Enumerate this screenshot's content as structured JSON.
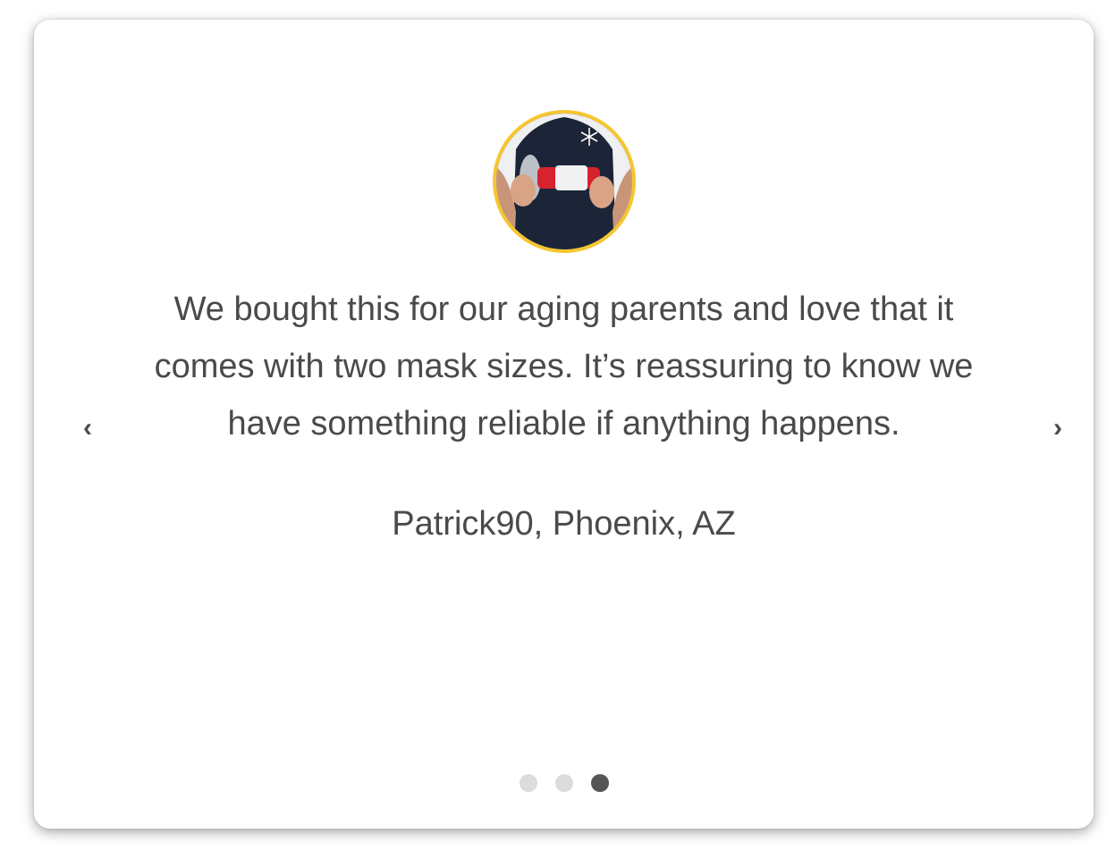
{
  "testimonial": {
    "quote": "We bought this for our aging parents and love that it comes with two mask sizes. It’s reassuring to know we have something reliable if anything happens.",
    "author": "Patrick90, Phoenix, AZ",
    "avatar_icon": "person-holding-anti-choking-device"
  },
  "carousel": {
    "prev_label": "‹",
    "next_label": "›",
    "total_slides": 3,
    "active_slide": 3
  },
  "colors": {
    "avatar_border": "#f6c630",
    "text": "#4a4a4a",
    "dot_inactive": "#dcdcdc",
    "dot_active": "#555555"
  }
}
